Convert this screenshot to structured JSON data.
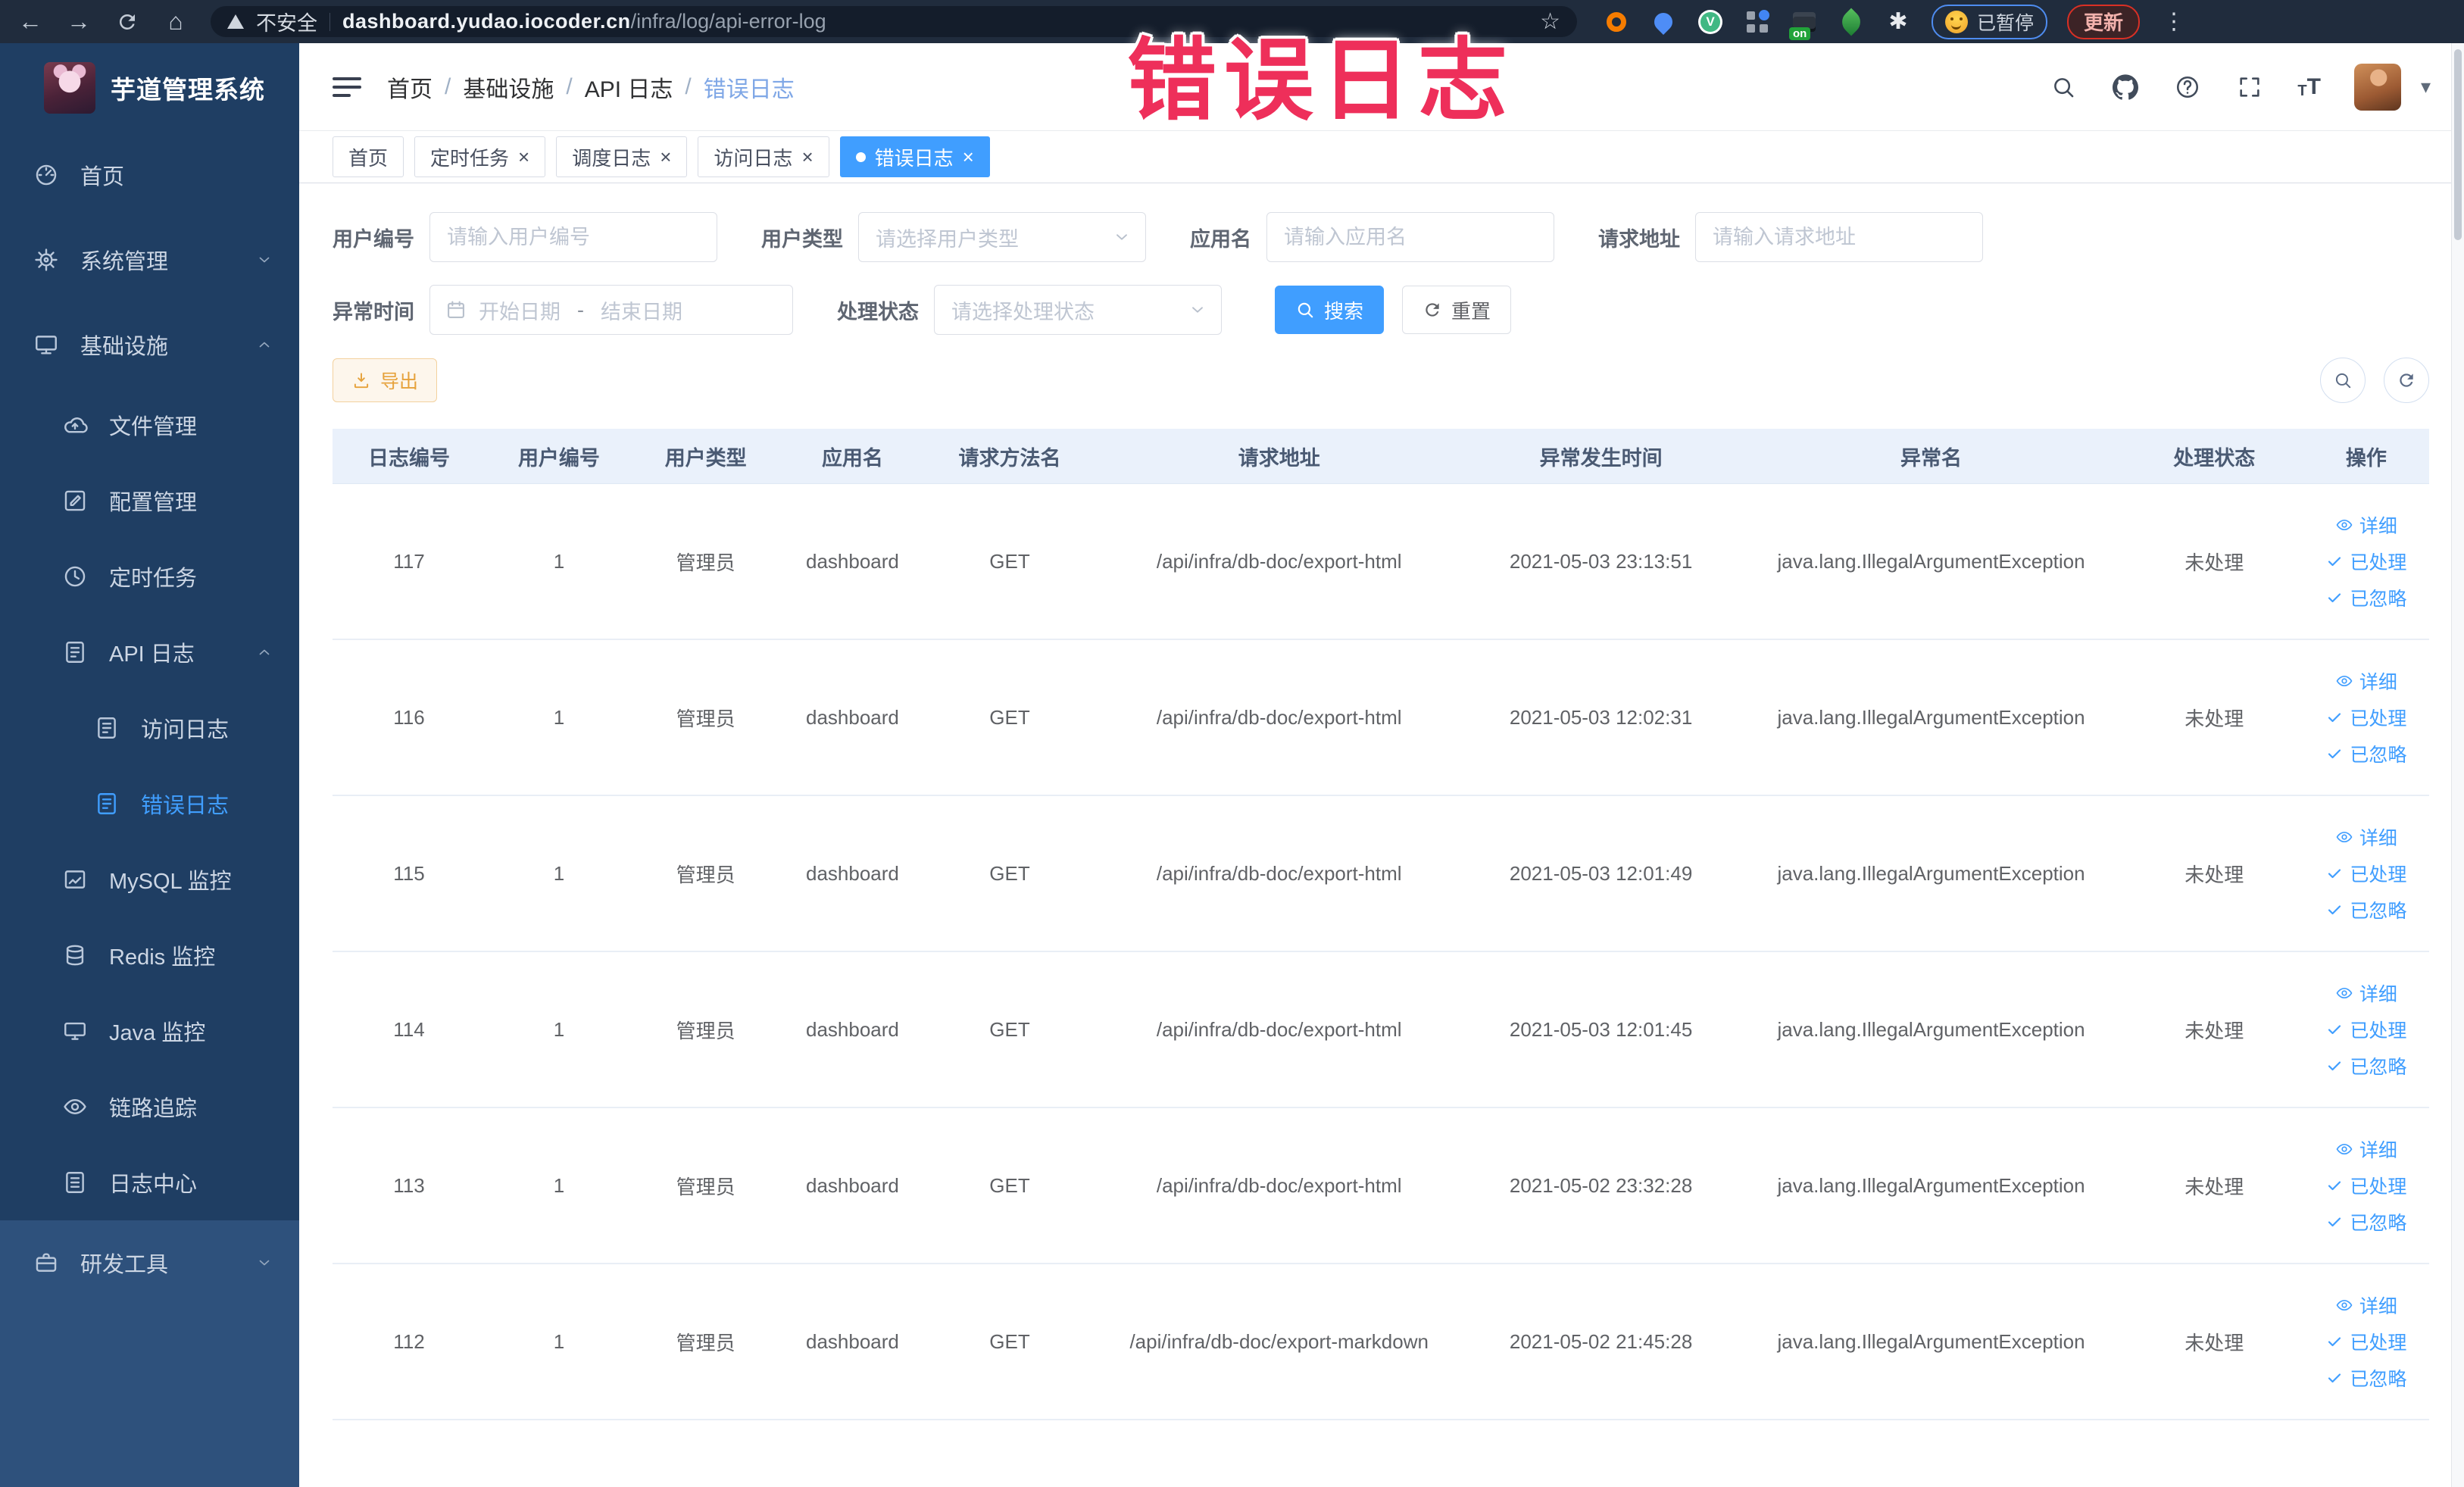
{
  "browser": {
    "security_label": "不安全",
    "url_domain": "dashboard.yudao.iocoder.cn",
    "url_path": "/infra/log/api-error-log",
    "ext_on_badge": "on",
    "paused_badge": "已暂停",
    "update_button": "更新"
  },
  "annotation": {
    "text": "错误日志",
    "color": "#ee2f5a"
  },
  "sidebar": {
    "title": "芋道管理系统",
    "items": [
      {
        "name": "home",
        "label": "首页",
        "icon": "dashboard-icon",
        "level": 1
      },
      {
        "name": "system-management",
        "label": "系统管理",
        "icon": "gear-icon",
        "level": 1,
        "chevron": "down"
      },
      {
        "name": "infrastructure",
        "label": "基础设施",
        "icon": "monitor-icon",
        "level": 1,
        "chevron": "up"
      },
      {
        "name": "file-management",
        "label": "文件管理",
        "icon": "cloud-upload-icon",
        "level": 2
      },
      {
        "name": "config-management",
        "label": "配置管理",
        "icon": "edit-icon",
        "level": 2
      },
      {
        "name": "scheduled-tasks",
        "label": "定时任务",
        "icon": "clock-icon",
        "level": 2
      },
      {
        "name": "api-logs",
        "label": "API 日志",
        "icon": "doc-edit-icon",
        "level": 2,
        "chevron": "up"
      },
      {
        "name": "access-logs",
        "label": "访问日志",
        "icon": "doc-edit-icon",
        "level": 3
      },
      {
        "name": "error-logs",
        "label": "错误日志",
        "icon": "doc-edit-icon",
        "level": 3,
        "active": true
      },
      {
        "name": "mysql-monitor",
        "label": "MySQL 监控",
        "icon": "chart-icon",
        "level": 2
      },
      {
        "name": "redis-monitor",
        "label": "Redis 监控",
        "icon": "database-icon",
        "level": 2
      },
      {
        "name": "java-monitor",
        "label": "Java 监控",
        "icon": "display-icon",
        "level": 2
      },
      {
        "name": "trace",
        "label": "链路追踪",
        "icon": "eye-icon",
        "level": 2
      },
      {
        "name": "log-center",
        "label": "日志中心",
        "icon": "doc-icon",
        "level": 2
      },
      {
        "name": "devtools",
        "label": "研发工具",
        "icon": "briefcase-icon",
        "level": 1,
        "chevron": "down",
        "light": true
      }
    ]
  },
  "breadcrumb": [
    "首页",
    "基础设施",
    "API 日志",
    "错误日志"
  ],
  "tabs": [
    {
      "name": "home",
      "label": "首页",
      "closable": false,
      "active": false
    },
    {
      "name": "scheduled-tasks",
      "label": "定时任务",
      "closable": true,
      "active": false
    },
    {
      "name": "schedule-logs",
      "label": "调度日志",
      "closable": true,
      "active": false
    },
    {
      "name": "access-logs",
      "label": "访问日志",
      "closable": true,
      "active": false
    },
    {
      "name": "error-logs",
      "label": "错误日志",
      "closable": true,
      "active": true
    }
  ],
  "filters": {
    "user_id": {
      "label": "用户编号",
      "placeholder": "请输入用户编号"
    },
    "user_type": {
      "label": "用户类型",
      "placeholder": "请选择用户类型"
    },
    "app_name": {
      "label": "应用名",
      "placeholder": "请输入应用名"
    },
    "request_url": {
      "label": "请求地址",
      "placeholder": "请输入请求地址"
    },
    "exception_time": {
      "label": "异常时间",
      "start_placeholder": "开始日期",
      "separator": "-",
      "end_placeholder": "结束日期"
    },
    "process_status": {
      "label": "处理状态",
      "placeholder": "请选择处理状态"
    },
    "search_button": "搜索",
    "reset_button": "重置"
  },
  "toolbar": {
    "export_button": "导出"
  },
  "table": {
    "columns": [
      "日志编号",
      "用户编号",
      "用户类型",
      "应用名",
      "请求方法名",
      "请求地址",
      "异常发生时间",
      "异常名",
      "处理状态",
      "操作"
    ],
    "actions": [
      "详细",
      "已处理",
      "已忽略"
    ],
    "rows": [
      {
        "id": "117",
        "user_id": "1",
        "user_type": "管理员",
        "app_name": "dashboard",
        "method": "GET",
        "request_url": "/api/infra/db-doc/export-html",
        "time": "2021-05-03 23:13:51",
        "exception": "java.lang.IllegalArgumentException",
        "status": "未处理"
      },
      {
        "id": "116",
        "user_id": "1",
        "user_type": "管理员",
        "app_name": "dashboard",
        "method": "GET",
        "request_url": "/api/infra/db-doc/export-html",
        "time": "2021-05-03 12:02:31",
        "exception": "java.lang.IllegalArgumentException",
        "status": "未处理"
      },
      {
        "id": "115",
        "user_id": "1",
        "user_type": "管理员",
        "app_name": "dashboard",
        "method": "GET",
        "request_url": "/api/infra/db-doc/export-html",
        "time": "2021-05-03 12:01:49",
        "exception": "java.lang.IllegalArgumentException",
        "status": "未处理"
      },
      {
        "id": "114",
        "user_id": "1",
        "user_type": "管理员",
        "app_name": "dashboard",
        "method": "GET",
        "request_url": "/api/infra/db-doc/export-html",
        "time": "2021-05-03 12:01:45",
        "exception": "java.lang.IllegalArgumentException",
        "status": "未处理"
      },
      {
        "id": "113",
        "user_id": "1",
        "user_type": "管理员",
        "app_name": "dashboard",
        "method": "GET",
        "request_url": "/api/infra/db-doc/export-html",
        "time": "2021-05-02 23:32:28",
        "exception": "java.lang.IllegalArgumentException",
        "status": "未处理"
      },
      {
        "id": "112",
        "user_id": "1",
        "user_type": "管理员",
        "app_name": "dashboard",
        "method": "GET",
        "request_url": "/api/infra/db-doc/export-markdown",
        "time": "2021-05-02 21:45:28",
        "exception": "java.lang.IllegalArgumentException",
        "status": "未处理"
      }
    ]
  }
}
